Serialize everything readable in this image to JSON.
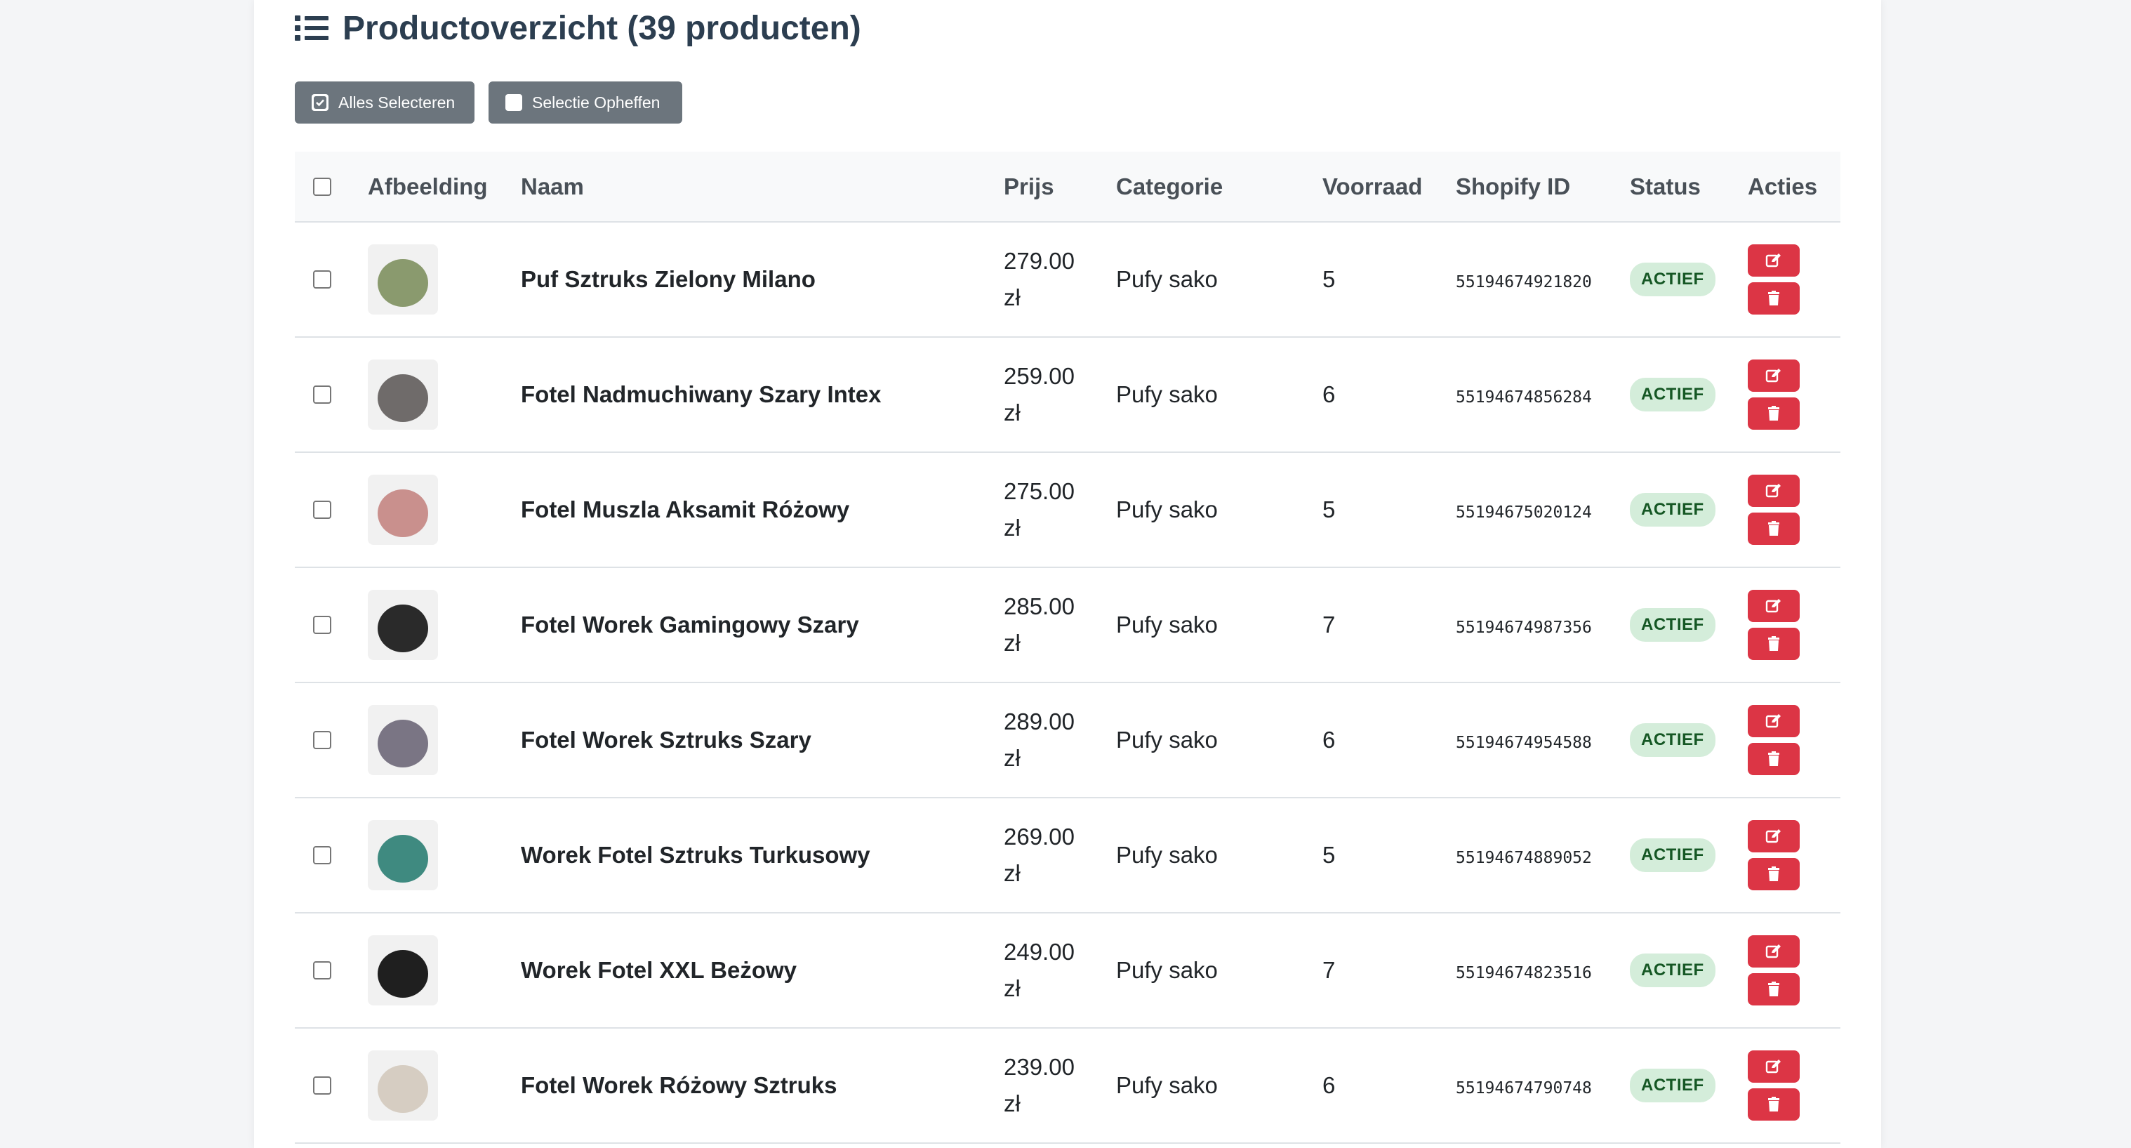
{
  "page": {
    "title": "Productoverzicht (39 producten)",
    "icon": "list-icon"
  },
  "toolbar": {
    "select_all_label": "Alles Selecteren",
    "deselect_label": "Selectie Opheffen"
  },
  "table": {
    "columns": [
      "Afbeelding",
      "Naam",
      "Prijs",
      "Categorie",
      "Voorraad",
      "Shopify ID",
      "Status",
      "Acties"
    ],
    "rows": [
      {
        "name": "Puf Sztruks Zielony Milano",
        "price": "279.00",
        "currency": "zł",
        "category": "Pufy sako",
        "stock": "5",
        "shopify_id": "55194674921820",
        "status": "ACTIEF",
        "thumb": "green-pouf",
        "thumb_color": "#8a9a6e"
      },
      {
        "name": "Fotel Nadmuchiwany Szary Intex",
        "price": "259.00",
        "currency": "zł",
        "category": "Pufy sako",
        "stock": "6",
        "shopify_id": "55194674856284",
        "status": "ACTIEF",
        "thumb": "grey-inflatable-chair",
        "thumb_color": "#6f6b6a"
      },
      {
        "name": "Fotel Muszla Aksamit Różowy",
        "price": "275.00",
        "currency": "zł",
        "category": "Pufy sako",
        "stock": "5",
        "shopify_id": "55194675020124",
        "status": "ACTIEF",
        "thumb": "pink-shell-chair",
        "thumb_color": "#c9908d"
      },
      {
        "name": "Fotel Worek Gamingowy Szary",
        "price": "285.00",
        "currency": "zł",
        "category": "Pufy sako",
        "stock": "7",
        "shopify_id": "55194674987356",
        "status": "ACTIEF",
        "thumb": "black-gaming-beanbag",
        "thumb_color": "#2a2a2a"
      },
      {
        "name": "Fotel Worek Sztruks Szary",
        "price": "289.00",
        "currency": "zł",
        "category": "Pufy sako",
        "stock": "6",
        "shopify_id": "55194674954588",
        "status": "ACTIEF",
        "thumb": "grey-corduroy-beanbag",
        "thumb_color": "#7a7584"
      },
      {
        "name": "Worek Fotel Sztruks Turkusowy",
        "price": "269.00",
        "currency": "zł",
        "category": "Pufy sako",
        "stock": "5",
        "shopify_id": "55194674889052",
        "status": "ACTIEF",
        "thumb": "turquoise-beanbag",
        "thumb_color": "#3f8a80"
      },
      {
        "name": "Worek Fotel XXL Beżowy",
        "price": "249.00",
        "currency": "zł",
        "category": "Pufy sako",
        "stock": "7",
        "shopify_id": "55194674823516",
        "status": "ACTIEF",
        "thumb": "black-xxl-beanbag",
        "thumb_color": "#1f1f1f"
      },
      {
        "name": "Fotel Worek Różowy Sztruks",
        "price": "239.00",
        "currency": "zł",
        "category": "Pufy sako",
        "stock": "6",
        "shopify_id": "55194674790748",
        "status": "ACTIEF",
        "thumb": "beige-corduroy-chair",
        "thumb_color": "#d6cdc2"
      }
    ]
  },
  "colors": {
    "button_grey": "#6c757d",
    "action_red": "#dc3545",
    "badge_bg": "#d4edda",
    "badge_text": "#155724",
    "title": "#2c3e50"
  }
}
